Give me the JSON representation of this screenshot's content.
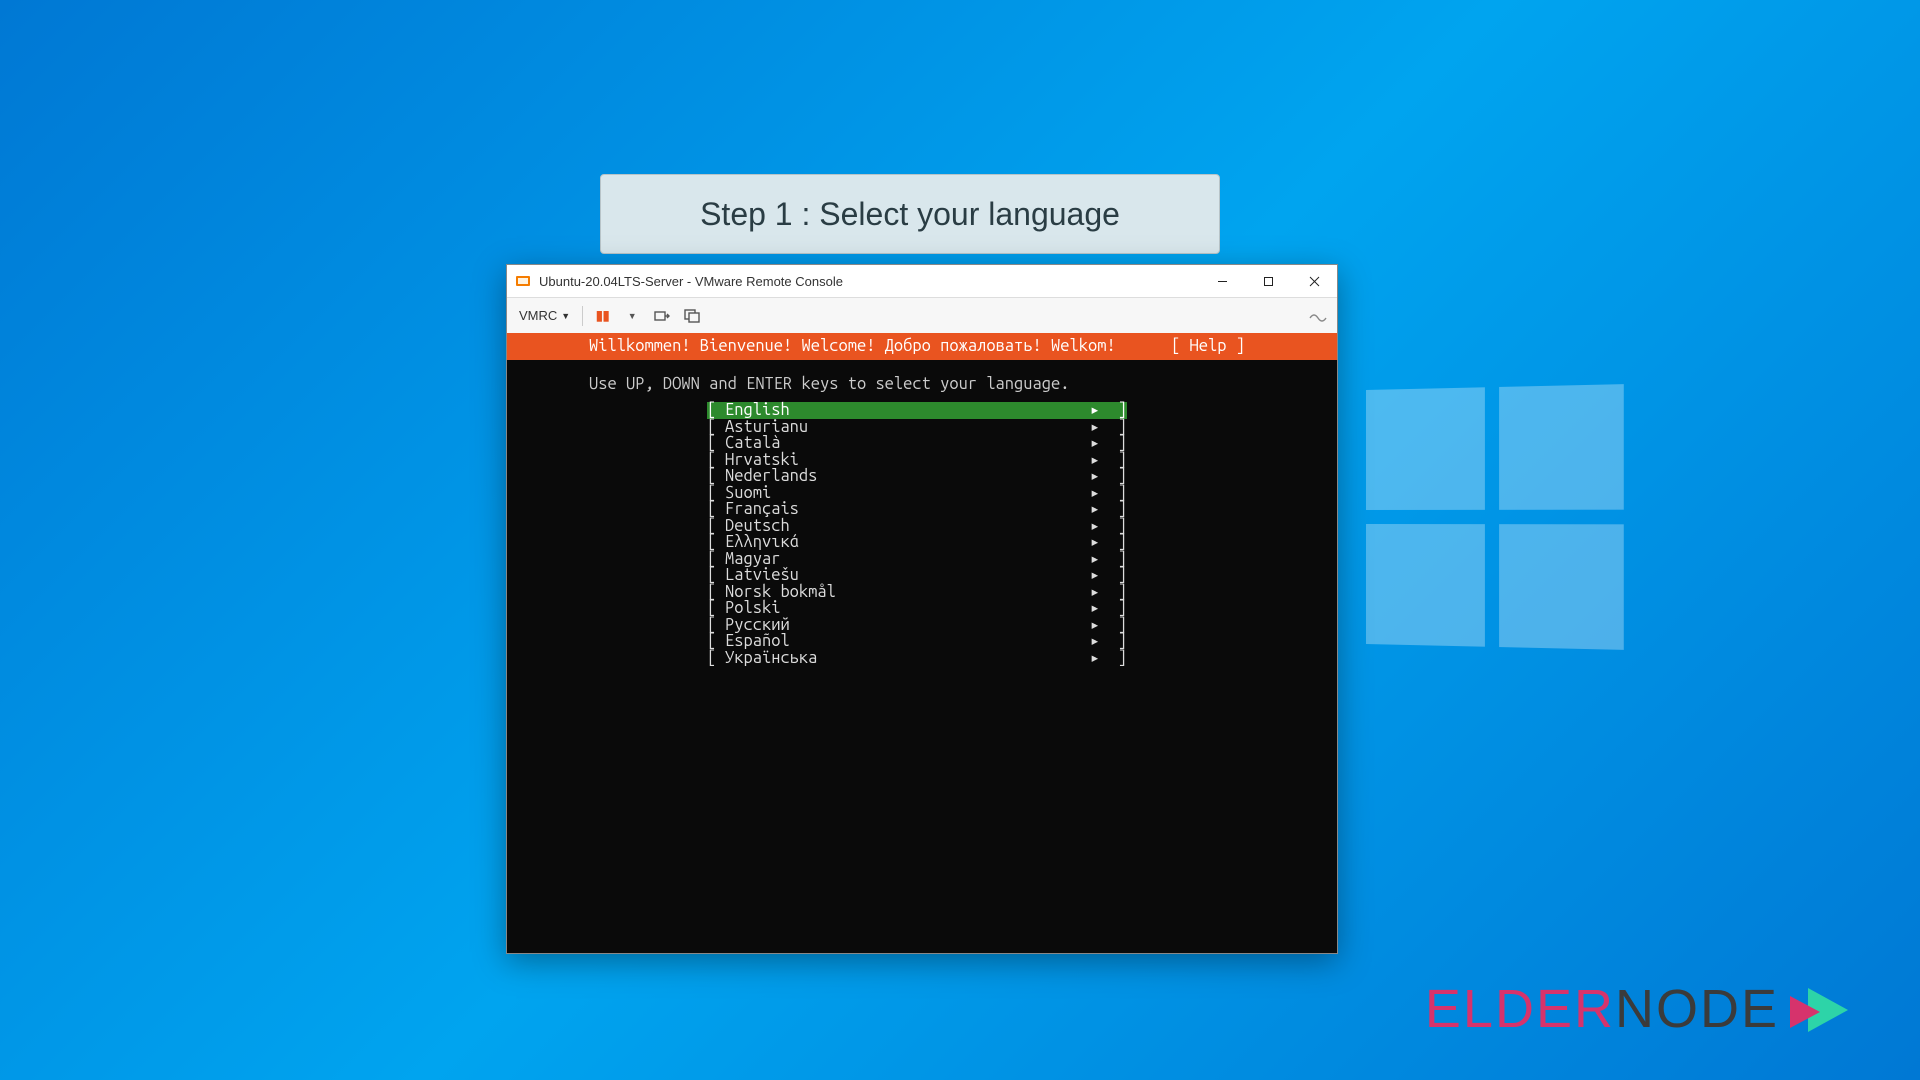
{
  "step_label": "Step 1 : Select your language",
  "window": {
    "title": "Ubuntu-20.04LTS-Server - VMware Remote Console",
    "menu_label": "VMRC"
  },
  "console": {
    "welcome": "Willkommen! Bienvenue! Welcome! Добро пожаловать! Welkom!",
    "help": "[ Help ]",
    "instruction": "Use UP, DOWN and ENTER keys to select your language.",
    "languages": [
      {
        "name": "English",
        "selected": true
      },
      {
        "name": "Asturianu",
        "selected": false
      },
      {
        "name": "Català",
        "selected": false
      },
      {
        "name": "Hrvatski",
        "selected": false
      },
      {
        "name": "Nederlands",
        "selected": false
      },
      {
        "name": "Suomi",
        "selected": false
      },
      {
        "name": "Français",
        "selected": false
      },
      {
        "name": "Deutsch",
        "selected": false
      },
      {
        "name": "Ελληνικά",
        "selected": false
      },
      {
        "name": "Magyar",
        "selected": false
      },
      {
        "name": "Latviešu",
        "selected": false
      },
      {
        "name": "Norsk bokmål",
        "selected": false
      },
      {
        "name": "Polski",
        "selected": false
      },
      {
        "name": "Русский",
        "selected": false
      },
      {
        "name": "Español",
        "selected": false
      },
      {
        "name": "Українська",
        "selected": false
      }
    ]
  },
  "watermark": {
    "part1": "Elder",
    "part2": "Node"
  }
}
